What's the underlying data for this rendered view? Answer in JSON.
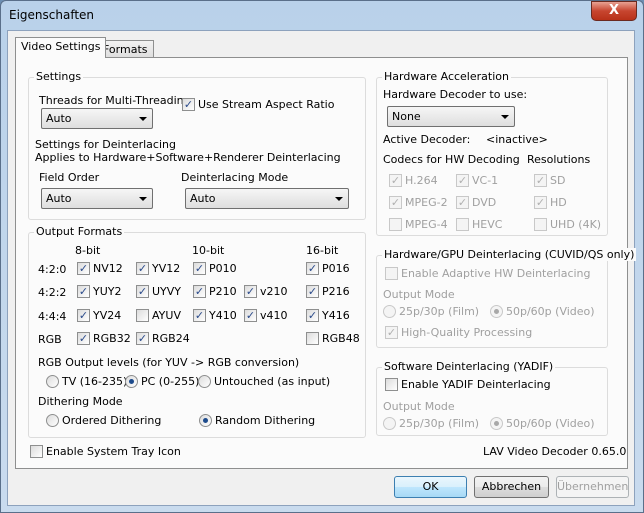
{
  "window": {
    "title": "Eigenschaften",
    "close_label": "X"
  },
  "tabs": [
    {
      "label": "Video Settings",
      "active": true
    },
    {
      "label": "Formats",
      "active": false
    }
  ],
  "settings": {
    "title": "Settings",
    "threads_label": "Threads for Multi-Threading",
    "threads_value": "Auto",
    "stream_aspect": {
      "label": "Use Stream Aspect Ratio",
      "checked": true
    },
    "deint_title": "Settings for Deinterlacing",
    "deint_sub": "Applies to Hardware+Software+Renderer Deinterlacing",
    "field_order_label": "Field Order",
    "field_order_value": "Auto",
    "deint_mode_label": "Deinterlacing Mode",
    "deint_mode_value": "Auto"
  },
  "output_formats": {
    "title": "Output Formats",
    "headers": [
      "8-bit",
      "10-bit",
      "16-bit"
    ],
    "rows": [
      {
        "label": "4:2:0",
        "items": [
          {
            "label": "NV12",
            "checked": true
          },
          {
            "label": "YV12",
            "checked": true
          },
          {
            "label": "P010",
            "checked": true
          },
          null,
          {
            "label": "P016",
            "checked": true
          }
        ]
      },
      {
        "label": "4:2:2",
        "items": [
          {
            "label": "YUY2",
            "checked": true
          },
          {
            "label": "UYVY",
            "checked": true
          },
          {
            "label": "P210",
            "checked": true
          },
          {
            "label": "v210",
            "checked": true
          },
          {
            "label": "P216",
            "checked": true
          }
        ]
      },
      {
        "label": "4:4:4",
        "items": [
          {
            "label": "YV24",
            "checked": true
          },
          {
            "label": "AYUV",
            "checked": false
          },
          {
            "label": "Y410",
            "checked": true
          },
          {
            "label": "v410",
            "checked": true
          },
          {
            "label": "Y416",
            "checked": true
          }
        ]
      },
      {
        "label": "RGB",
        "items": [
          {
            "label": "RGB32",
            "checked": true
          },
          {
            "label": "RGB24",
            "checked": true
          },
          null,
          null,
          {
            "label": "RGB48",
            "checked": false
          }
        ]
      }
    ],
    "rgb_levels_label": "RGB Output levels (for YUV -> RGB conversion)",
    "rgb_levels": [
      {
        "label": "TV (16-235)",
        "selected": false
      },
      {
        "label": "PC (0-255)",
        "selected": true
      },
      {
        "label": "Untouched (as input)",
        "selected": false
      }
    ],
    "dither_label": "Dithering Mode",
    "dither": [
      {
        "label": "Ordered Dithering",
        "selected": false
      },
      {
        "label": "Random Dithering",
        "selected": true
      }
    ]
  },
  "tray": {
    "label": "Enable System Tray Icon",
    "checked": false
  },
  "hw": {
    "title": "Hardware Acceleration",
    "decoder_label": "Hardware Decoder to use:",
    "decoder_value": "None",
    "active_label": "Active Decoder:",
    "active_value": "<inactive>",
    "codecs_label": "Codecs for HW Decoding",
    "res_label": "Resolutions",
    "codecs": [
      {
        "label": "H.264",
        "checked": true
      },
      {
        "label": "VC-1",
        "checked": true
      },
      {
        "label": "MPEG-2",
        "checked": true
      },
      {
        "label": "DVD",
        "checked": true
      },
      {
        "label": "MPEG-4",
        "checked": false
      },
      {
        "label": "HEVC",
        "checked": false
      }
    ],
    "resolutions": [
      {
        "label": "SD",
        "checked": true
      },
      {
        "label": "HD",
        "checked": true
      },
      {
        "label": "UHD (4K)",
        "checked": false
      }
    ]
  },
  "hwdeint": {
    "title": "Hardware/GPU Deinterlacing (CUVID/QS only)",
    "enable": {
      "label": "Enable Adaptive HW Deinterlacing",
      "checked": false
    },
    "output_label": "Output Mode",
    "modes": [
      {
        "label": "25p/30p (Film)",
        "selected": false
      },
      {
        "label": "50p/60p (Video)",
        "selected": true
      }
    ],
    "hq": {
      "label": "High-Quality Processing",
      "checked": true
    }
  },
  "swdeint": {
    "title": "Software Deinterlacing (YADIF)",
    "enable": {
      "label": "Enable YADIF Deinterlacing",
      "checked": false
    },
    "output_label": "Output Mode",
    "modes": [
      {
        "label": "25p/30p (Film)",
        "selected": false
      },
      {
        "label": "50p/60p (Video)",
        "selected": true
      }
    ]
  },
  "version": "LAV Video Decoder 0.65.0",
  "buttons": {
    "ok": "OK",
    "cancel": "Abbrechen",
    "apply": "Übernehmen"
  }
}
